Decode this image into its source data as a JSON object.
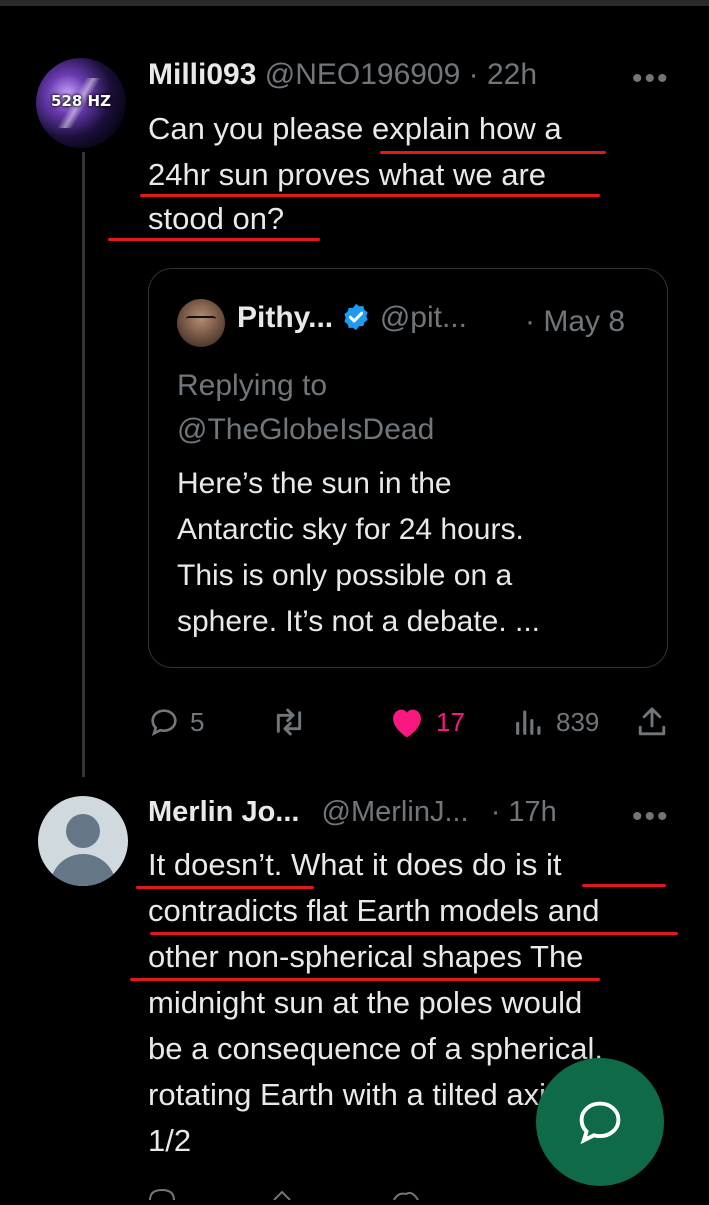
{
  "tweet1": {
    "avatar_text": "528 HZ",
    "name": "Milli093",
    "handle": "@NEO196909",
    "time": "· 22h",
    "more": "•••",
    "lines": [
      "Can you please explain how a",
      "24hr sun proves what we are",
      "stood on?"
    ],
    "quote": {
      "name": "Pithy...",
      "handle": "@pit...",
      "date": "· May 8",
      "replying_label": "Replying to",
      "replying_handle": "@TheGlobeIsDead",
      "lines": [
        "Here’s the sun in the",
        "Antarctic sky for 24 hours.",
        "This is only possible on a",
        "sphere. It’s not a debate. ..."
      ]
    },
    "actions": {
      "replies": "5",
      "likes": "17",
      "views": "839"
    }
  },
  "tweet2": {
    "name": "Merlin Jo...",
    "handle": "@MerlinJ...",
    "time": "· 17h",
    "more": "•••",
    "lines": [
      "It doesn’t. What it does do is it",
      "contradicts flat Earth models and",
      "other non-spherical shapes The",
      "midnight sun at the poles would",
      "be a consequence of a spherical,",
      "rotating Earth with a tilted axis.",
      "1/2"
    ]
  },
  "colors": {
    "background": "#000000",
    "text": "#e7e9ea",
    "muted": "#71767b",
    "like": "#f91880",
    "verified": "#1d9bf0",
    "annotation": "#e0191c",
    "fab": "#0f6b47"
  },
  "icons": [
    "reply-icon",
    "retweet-icon",
    "heart-icon",
    "views-icon",
    "share-icon",
    "verified-badge-icon",
    "compose-reply-icon"
  ]
}
